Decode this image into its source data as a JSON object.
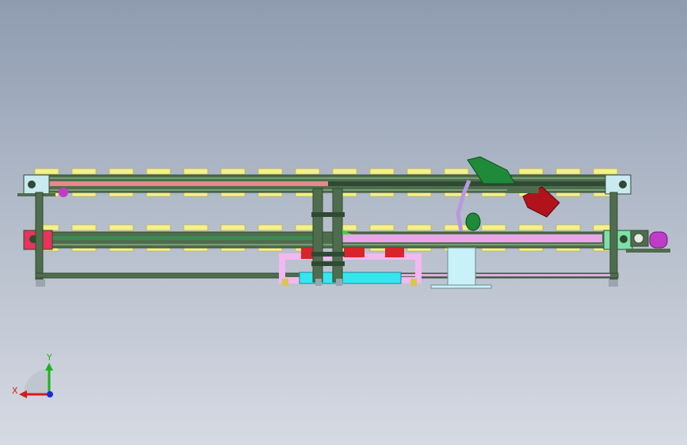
{
  "viewport": {
    "colors": {
      "bg_top": "#8e9bb0",
      "bg_bottom": "#d6dae3",
      "frame": "#4f6d4e",
      "frame_dark": "#2f4a32",
      "roller": "#f4f08a",
      "rail_top_pink": "#e48a8a",
      "rail_bottom_pink": "#e6a8e6",
      "end_block_top": "#c9eaf0",
      "end_block_bottom_left": "#e8345c",
      "end_block_bottom_right": "#7de0a8",
      "lift_base": "#f3b8ef",
      "lift_red": "#d8242a",
      "lift_cyan": "#36e6ef",
      "robot_green": "#1f8a3a",
      "robot_red": "#b1121c",
      "robot_purple": "#b998e0",
      "motor_purple": "#c03cc8",
      "pedestal": "#c8f2f7"
    }
  },
  "triad": {
    "x_label": "X",
    "y_label": "Y",
    "x_color": "#d41c1c",
    "y_color": "#1cb41c",
    "z_color": "#1c2cd4"
  }
}
